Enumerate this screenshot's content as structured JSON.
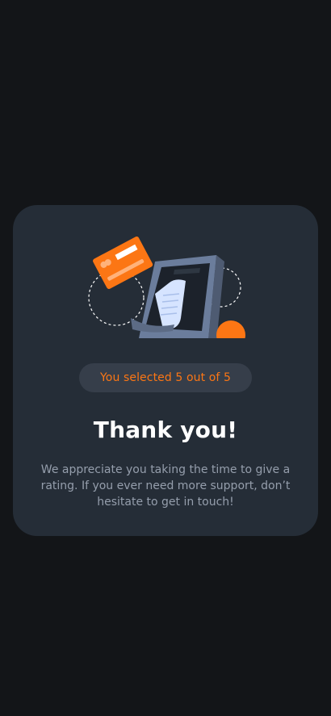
{
  "card": {
    "selection_text": "You selected 5 out of 5",
    "title": "Thank you!",
    "message": "We appreciate you taking the time to give a rating. If you ever need more support, don’t hesitate to get in touch!",
    "illustration_icon": "payment-receipt-illustration"
  },
  "colors": {
    "page_background": "#131518",
    "card_background": "#252D37",
    "badge_background": "#363E4A",
    "accent": "#FC7614",
    "text_primary": "#FFFFFF",
    "text_muted": "#959EAC"
  }
}
